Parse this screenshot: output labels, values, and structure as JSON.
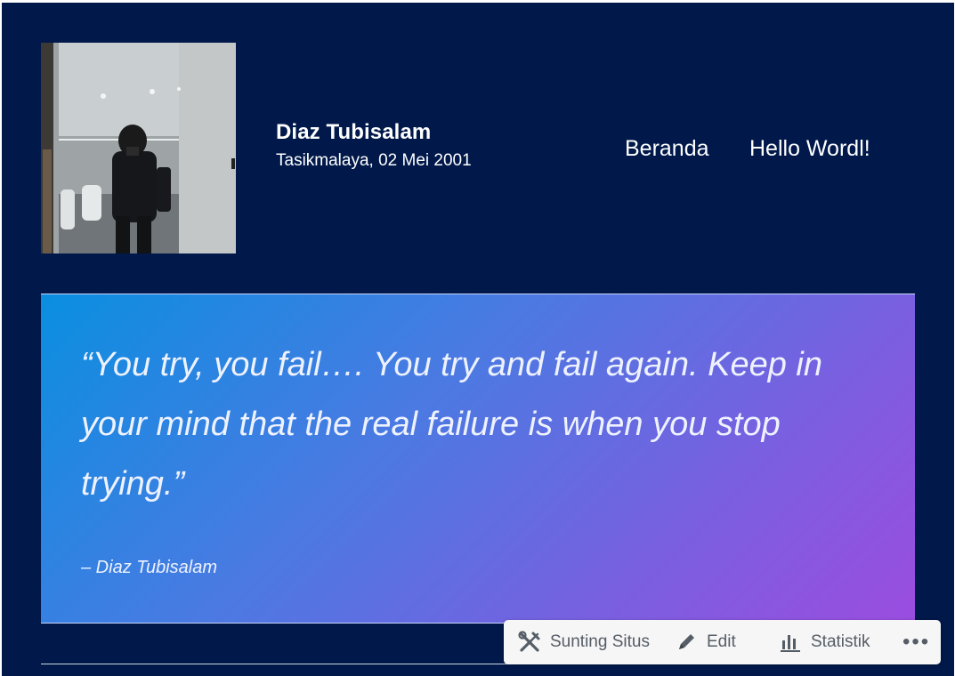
{
  "site": {
    "title": "Diaz Tubisalam",
    "description": "Tasikmalaya, 02 Mei 2001",
    "background_color": "#00184a"
  },
  "avatar": {
    "icon": "profile-photo"
  },
  "nav": {
    "items": [
      {
        "label": "Beranda"
      },
      {
        "label": "Hello Wordl!"
      }
    ]
  },
  "quote": {
    "text": "“You try, you fail…. You try and fail again. Keep in your mind that the real failure is when you stop trying.”",
    "citation": "– Diaz Tubisalam",
    "gradient_colors": [
      "#0a8fe0",
      "#9b4de0"
    ]
  },
  "admin_bar": {
    "items": [
      {
        "label": "Sunting Situs",
        "icon": "tools-icon"
      },
      {
        "label": "Edit",
        "icon": "pencil-icon"
      },
      {
        "label": "Statistik",
        "icon": "bar-chart-icon"
      }
    ],
    "more_label": "•••",
    "more_icon": "more-icon"
  }
}
